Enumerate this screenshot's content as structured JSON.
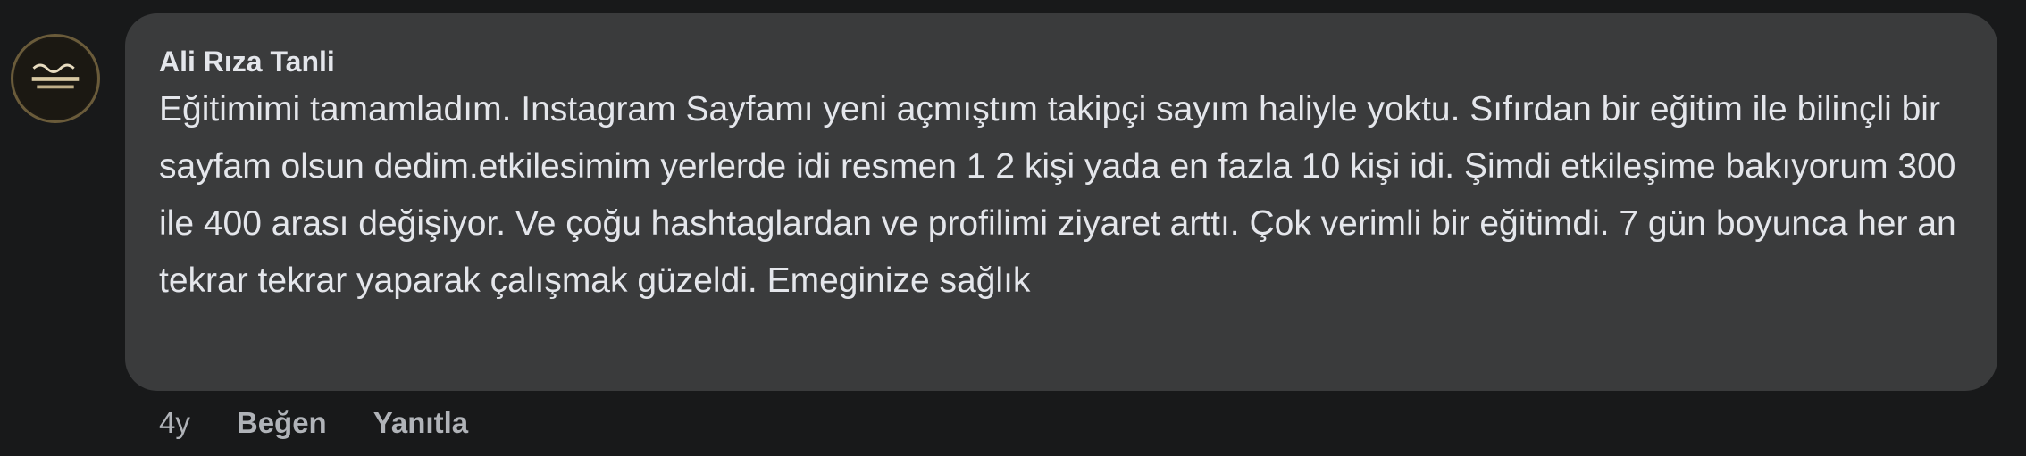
{
  "comment": {
    "author": "Ali Rıza Tanli",
    "avatar": {
      "label": "avatar-logo",
      "accent": "#6a5b3a"
    },
    "text": "Eğitimimi tamamladım. Instagram Sayfamı yeni açmıştım takipçi sayım haliyle yoktu. Sıfırdan bir eğitim ile bilinçli bir sayfam olsun dedim.etkilesimim yerlerde idi resmen 1 2 kişi yada en fazla 10 kişi idi. Şimdi etkileşime bakıyorum 300 ile 400 arası değişiyor. Ve çoğu hashtaglardan ve profilimi ziyaret arttı. Çok verimli bir eğitimdi. 7 gün boyunca her an tekrar tekrar yaparak çalışmak güzeldi. Emeginize sağlık",
    "timestamp": "4y",
    "like_label": "Beğen",
    "reply_label": "Yanıtla"
  },
  "colors": {
    "background": "#18191a",
    "bubble": "#3a3b3c",
    "text": "#e4e6eb",
    "secondary_text": "#b0b3b8"
  }
}
